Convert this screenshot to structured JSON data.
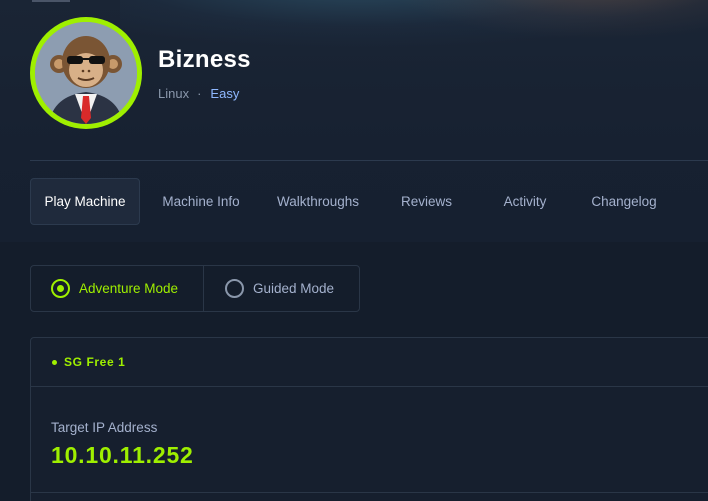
{
  "machine": {
    "name": "Bizness",
    "os": "Linux",
    "separator": "·",
    "difficulty": "Easy",
    "avatar_icon": "monkey-in-suit-avatar"
  },
  "tabs": [
    {
      "label": "Play Machine",
      "active": true
    },
    {
      "label": "Machine Info",
      "active": false
    },
    {
      "label": "Walkthroughs",
      "active": false
    },
    {
      "label": "Reviews",
      "active": false
    },
    {
      "label": "Activity",
      "active": false
    },
    {
      "label": "Changelog",
      "active": false
    }
  ],
  "modes": {
    "adventure": {
      "label": "Adventure Mode",
      "selected": true
    },
    "guided": {
      "label": "Guided Mode",
      "selected": false
    }
  },
  "instance": {
    "server": "SG Free 1",
    "ip_label": "Target IP Address",
    "ip_value": "10.10.11.252"
  },
  "colors": {
    "accent": "#9fef00",
    "background": "#141d2b",
    "difficulty": "#8fb8ff"
  }
}
